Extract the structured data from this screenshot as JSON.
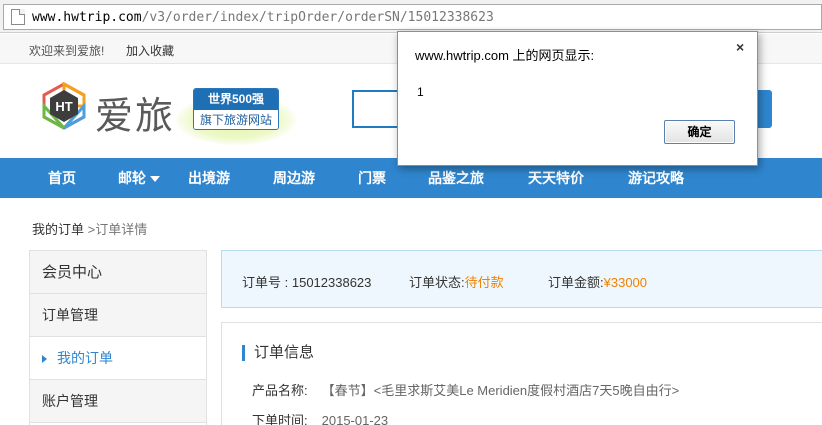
{
  "browser": {
    "url_host": "www.hwtrip.com",
    "url_path": "/v3/order/index/tripOrder/orderSN/15012338623"
  },
  "toplinks": {
    "welcome": "欢迎来到爱旅!",
    "bookmark": "加入收藏"
  },
  "header": {
    "logo_mark": "HT",
    "logo_text": "爱旅",
    "badge_top": "世界500强",
    "badge_bottom": "旗下旅游网站"
  },
  "nav": {
    "items": [
      {
        "label": "首页"
      },
      {
        "label": "邮轮"
      },
      {
        "label": "出境游"
      },
      {
        "label": "周边游"
      },
      {
        "label": "门票"
      },
      {
        "label": "品鉴之旅"
      },
      {
        "label": "天天特价"
      },
      {
        "label": "游记攻略"
      }
    ]
  },
  "breadcrumb": {
    "home": "我的订单",
    "current": ">订单详情"
  },
  "sidebar": {
    "title": "会员中心",
    "group1": "订单管理",
    "active_item": "我的订单",
    "group2": "账户管理"
  },
  "summary": {
    "order_no_label": "订单号 :",
    "order_no": "15012338623",
    "status_label": "订单状态:",
    "status": "待付款",
    "amount_label": "订单金额:",
    "amount": "¥33000"
  },
  "order_info": {
    "title": "订单信息",
    "product_label": "产品名称:",
    "product_name": "【春节】<毛里求斯艾美Le Meridien度假村酒店7天5晚自由行>",
    "date_label": "下单时间:",
    "date": "2015-01-23"
  },
  "dialog": {
    "title": "www.hwtrip.com 上的网页显示:",
    "close": "×",
    "message": "1",
    "ok_label": "确定"
  },
  "colors": {
    "accent": "#2f86cf",
    "status_orange": "#f08200",
    "summary_bg": "#eef7fd"
  }
}
